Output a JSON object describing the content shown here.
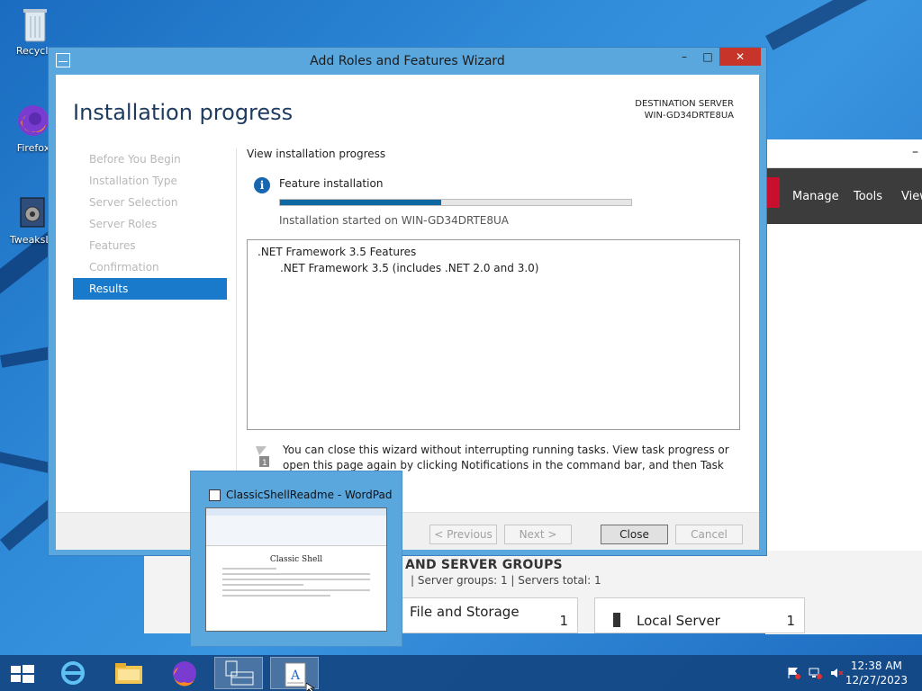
{
  "desktop": {
    "icons": [
      {
        "label": "Recycle",
        "icon": "recycle-bin-icon"
      },
      {
        "label": "Firefox",
        "icon": "firefox-icon"
      },
      {
        "label": "TweaksLo",
        "icon": "tweaks-icon"
      }
    ]
  },
  "server_manager": {
    "menu": [
      "Manage",
      "Tools",
      "View"
    ],
    "groups_heading": "AND SERVER GROUPS",
    "groups_sub": "|   Server groups: 1   |   Servers total: 1",
    "tiles": [
      {
        "label": "File and Storage",
        "count": "1"
      },
      {
        "label": "Local Server",
        "count": "1"
      }
    ]
  },
  "wizard": {
    "title": "Add Roles and Features Wizard",
    "heading": "Installation progress",
    "dest_label": "DESTINATION SERVER",
    "dest_value": "WIN-GD34DRTE8UA",
    "nav": [
      "Before You Begin",
      "Installation Type",
      "Server Selection",
      "Server Roles",
      "Features",
      "Confirmation",
      "Results"
    ],
    "active_nav_index": 6,
    "content": {
      "caption": "View installation progress",
      "feature_label": "Feature installation",
      "progress_fraction": 0.46,
      "started_text": "Installation started on WIN-GD34DRTE8UA",
      "results": [
        ".NET Framework 3.5 Features",
        ".NET Framework 3.5 (includes .NET 2.0 and 3.0)"
      ],
      "notice": "You can close this wizard without interrupting running tasks. View task progress or open this page again by clicking Notifications in the command bar, and then Task Details.",
      "notice_badge": "1"
    },
    "buttons": {
      "previous": "< Previous",
      "next": "Next >",
      "close": "Close",
      "cancel": "Cancel"
    },
    "titlebar": {
      "minimize": "–",
      "maximize": "□",
      "close": "✕"
    }
  },
  "thumbnail": {
    "title": "ClassicShellReadme - WordPad",
    "doc_heading": "Classic Shell"
  },
  "taskbar": {
    "time": "12:38 AM",
    "date": "12/27/2023"
  },
  "colors": {
    "accent": "#1979ca",
    "progress": "#0f6aa3",
    "close": "#c7352a"
  }
}
